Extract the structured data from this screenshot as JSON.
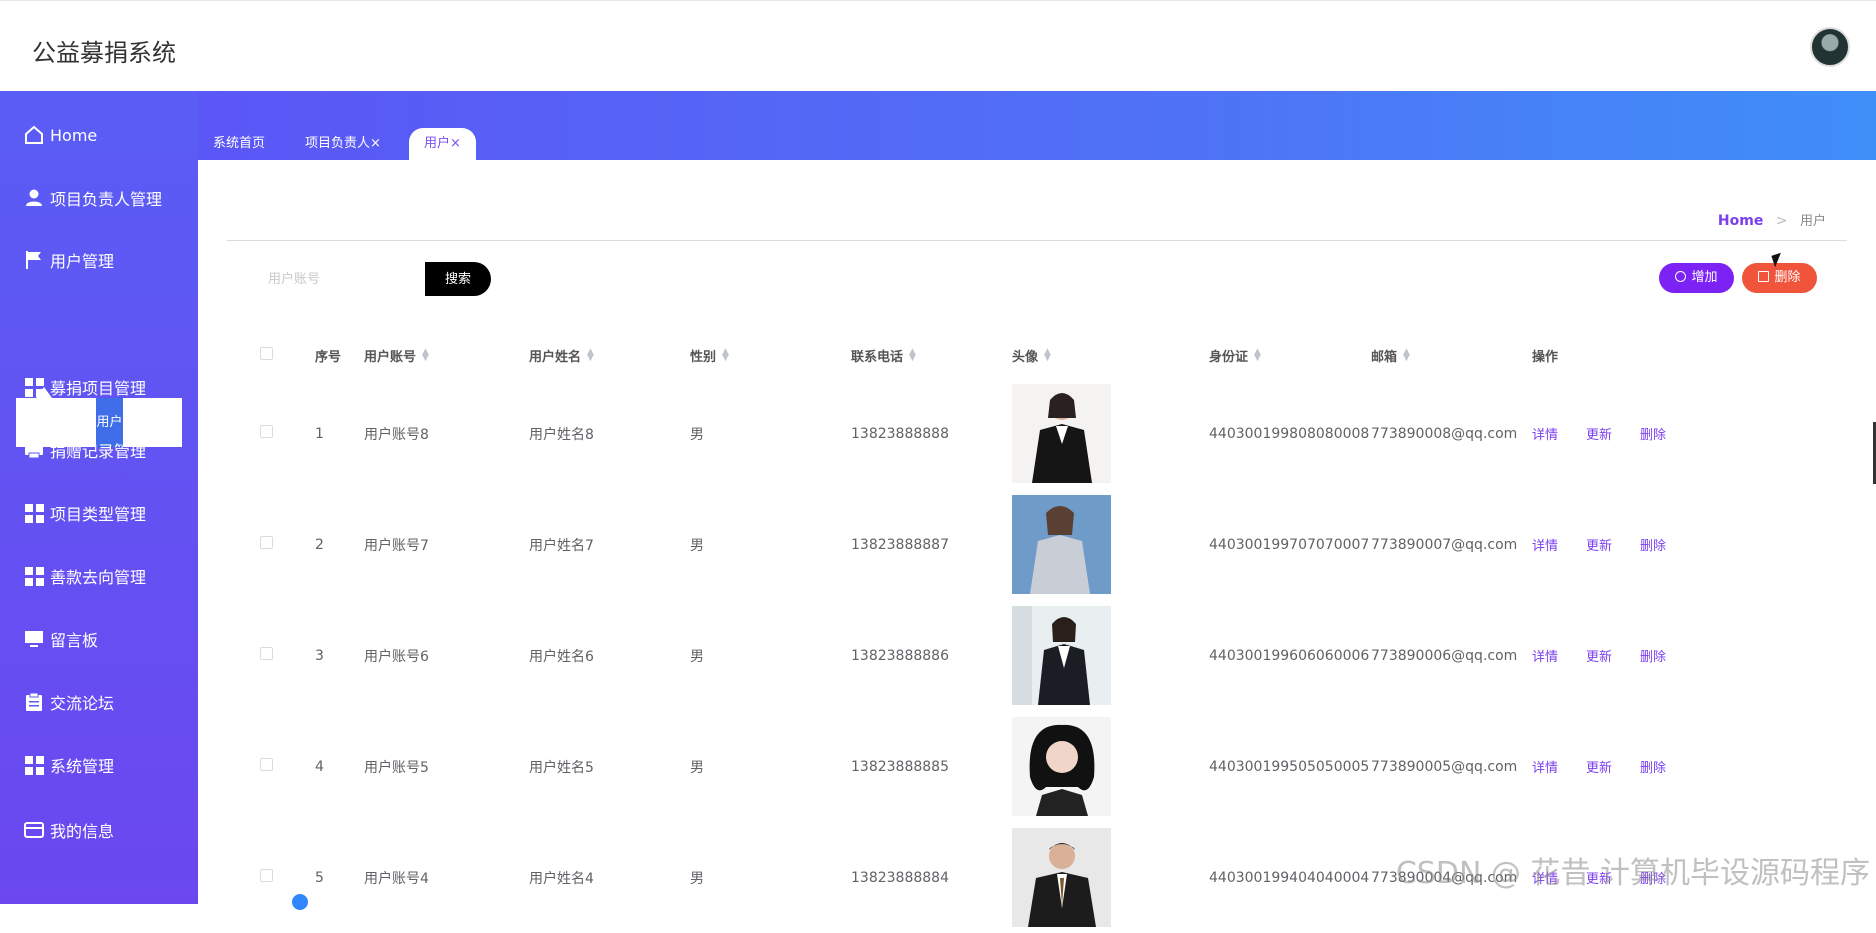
{
  "app": {
    "title": "公益募捐系统"
  },
  "sidebar": {
    "items": [
      {
        "label": "Home",
        "icon": "home-icon"
      },
      {
        "label": "项目负责人管理",
        "icon": "user-icon"
      },
      {
        "label": "用户管理",
        "icon": "flag-icon"
      },
      {
        "label": "募捐项目管理",
        "icon": "grid-icon"
      },
      {
        "label": "捐赠记录管理",
        "icon": "printer-icon"
      },
      {
        "label": "项目类型管理",
        "icon": "grid-icon"
      },
      {
        "label": "善款去向管理",
        "icon": "grid-icon"
      },
      {
        "label": "留言板",
        "icon": "monitor-icon"
      },
      {
        "label": "交流论坛",
        "icon": "clipboard-icon"
      },
      {
        "label": "系统管理",
        "icon": "grid-icon"
      },
      {
        "label": "我的信息",
        "icon": "card-icon"
      }
    ],
    "submenu_active": "用户"
  },
  "tabs": [
    {
      "label": "系统首页"
    },
    {
      "label": "项目负责人",
      "close": "×"
    },
    {
      "label": "用户",
      "close": "×",
      "active": true
    }
  ],
  "breadcrumb": {
    "home": "Home",
    "sep": ">",
    "current": "用户"
  },
  "search": {
    "placeholder": "用户账号",
    "button": "搜索"
  },
  "toolbar": {
    "add": "增加",
    "delete": "删除"
  },
  "table": {
    "headers": {
      "index": "序号",
      "account": "用户账号",
      "name": "用户姓名",
      "gender": "性别",
      "phone": "联系电话",
      "avatar": "头像",
      "id_card": "身份证",
      "email": "邮箱",
      "actions": "操作"
    },
    "actions": {
      "detail": "详情",
      "update": "更新",
      "delete": "删除"
    },
    "rows": [
      {
        "index": "1",
        "account": "用户账号8",
        "name": "用户姓名8",
        "gender": "男",
        "phone": "13823888888",
        "id_card": "440300199808080008",
        "email": "773890008@qq.com"
      },
      {
        "index": "2",
        "account": "用户账号7",
        "name": "用户姓名7",
        "gender": "男",
        "phone": "13823888887",
        "id_card": "440300199707070007",
        "email": "773890007@qq.com"
      },
      {
        "index": "3",
        "account": "用户账号6",
        "name": "用户姓名6",
        "gender": "男",
        "phone": "13823888886",
        "id_card": "440300199606060006",
        "email": "773890006@qq.com"
      },
      {
        "index": "4",
        "account": "用户账号5",
        "name": "用户姓名5",
        "gender": "男",
        "phone": "13823888885",
        "id_card": "440300199505050005",
        "email": "773890005@qq.com"
      },
      {
        "index": "5",
        "account": "用户账号4",
        "name": "用户姓名4",
        "gender": "男",
        "phone": "13823888884",
        "id_card": "440300199404040004",
        "email": "773890004@qq.com"
      }
    ]
  },
  "watermark": "CSDN @ 花昔 计算机毕设源码程序",
  "colors": {
    "accent": "#7b3ff0",
    "sidebar": "#5a5df5",
    "danger": "#f0553b"
  }
}
